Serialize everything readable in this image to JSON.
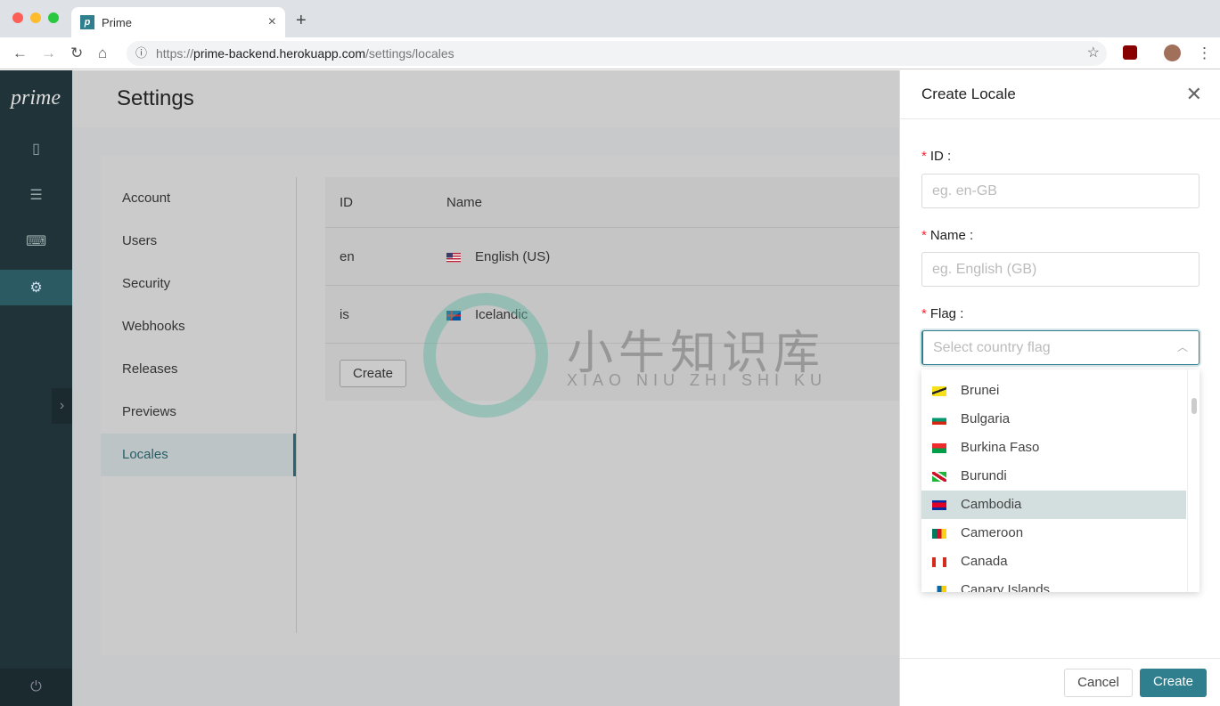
{
  "browser": {
    "tab_title": "Prime",
    "favicon_letter": "p",
    "url_scheme": "https://",
    "url_host": "prime-backend.herokuapp.com",
    "url_path": "/settings/locales"
  },
  "sidebar": {
    "logo": "prime",
    "items": [
      {
        "icon": "document-icon"
      },
      {
        "icon": "list-icon"
      },
      {
        "icon": "terminal-icon"
      },
      {
        "icon": "gear-icon",
        "active": true
      }
    ]
  },
  "header": {
    "title": "Settings"
  },
  "settings_menu": [
    {
      "label": "Account"
    },
    {
      "label": "Users"
    },
    {
      "label": "Security"
    },
    {
      "label": "Webhooks"
    },
    {
      "label": "Releases"
    },
    {
      "label": "Previews"
    },
    {
      "label": "Locales",
      "active": true
    }
  ],
  "table": {
    "columns": [
      "ID",
      "Name"
    ],
    "rows": [
      {
        "id": "en",
        "name": "English (US)",
        "flag": "us"
      },
      {
        "id": "is",
        "name": "Icelandic",
        "flag": "is"
      }
    ],
    "create_label": "Create"
  },
  "watermark": {
    "text": "小牛知识库",
    "sub": "XIAO NIU ZHI SHI KU"
  },
  "drawer": {
    "title": "Create Locale",
    "id_label": "ID",
    "id_placeholder": "eg. en-GB",
    "name_label": "Name",
    "name_placeholder": "eg. English (GB)",
    "flag_label": "Flag",
    "flag_placeholder": "Select country flag",
    "options": [
      {
        "label": "Brunei"
      },
      {
        "label": "Bulgaria"
      },
      {
        "label": "Burkina Faso"
      },
      {
        "label": "Burundi"
      },
      {
        "label": "Cambodia",
        "highlighted": true
      },
      {
        "label": "Cameroon"
      },
      {
        "label": "Canada"
      },
      {
        "label": "Canary Islands"
      }
    ],
    "cancel_label": "Cancel",
    "create_label": "Create"
  },
  "colors": {
    "accent": "#2f7f8e",
    "sidebar": "#1f3339",
    "required": "#f5222d"
  }
}
